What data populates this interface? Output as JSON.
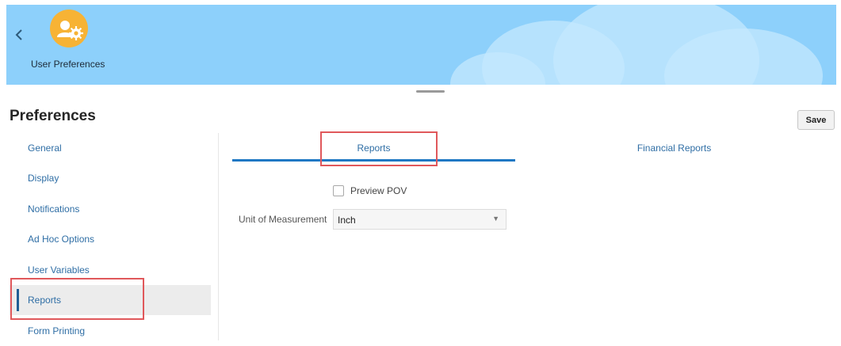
{
  "header": {
    "back_icon": "chevron-left-icon",
    "app_icon": "user-settings-icon",
    "app_title": "User Preferences"
  },
  "page": {
    "title": "Preferences",
    "save_label": "Save"
  },
  "sidebar": {
    "items": [
      {
        "label": "General",
        "active": false
      },
      {
        "label": "Display",
        "active": false
      },
      {
        "label": "Notifications",
        "active": false
      },
      {
        "label": "Ad Hoc Options",
        "active": false
      },
      {
        "label": "User Variables",
        "active": false
      },
      {
        "label": "Reports",
        "active": true
      },
      {
        "label": "Form Printing",
        "active": false
      }
    ]
  },
  "tabs": [
    {
      "label": "Reports",
      "active": true
    },
    {
      "label": "Financial Reports",
      "active": false
    }
  ],
  "form": {
    "preview_pov_label": "Preview POV",
    "preview_pov_checked": false,
    "unit_label": "Unit of Measurement",
    "unit_value": "Inch"
  },
  "colors": {
    "banner": "#8dd0fb",
    "accent": "#1f78c4",
    "link": "#2f6ea5",
    "highlight": "#e0585b",
    "app_icon": "#f7b335"
  }
}
